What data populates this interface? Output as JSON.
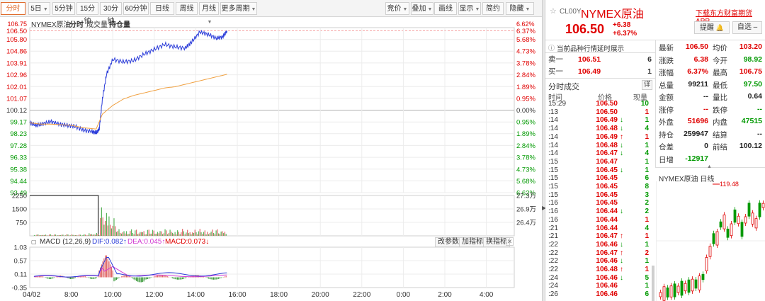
{
  "toolbar": {
    "tabs": [
      {
        "label": "分时",
        "active": true
      },
      {
        "label": "5日",
        "caret": true
      },
      {
        "label": "5分钟"
      },
      {
        "label": "15分钟"
      },
      {
        "label": "30分钟"
      },
      {
        "label": "60分钟"
      },
      {
        "label": "日线"
      },
      {
        "label": "周线"
      },
      {
        "label": "月线",
        "caret": true
      },
      {
        "label": "更多周期",
        "caret": true
      }
    ],
    "right_buttons": [
      {
        "label": "竞价",
        "caret": true
      },
      {
        "label": "叠加",
        "caret": true
      },
      {
        "label": "画线"
      },
      {
        "label": "显示",
        "caret": true
      },
      {
        "label": "简约"
      },
      {
        "label": "隐藏",
        "caret": true
      }
    ]
  },
  "chart_header": {
    "name": "NYMEX原油",
    "tab_fenshi": "分时",
    "tab_volume": "成交量",
    "tab_oi": "持仓量"
  },
  "price_axis": {
    "labels": [
      "106.50",
      "105.80",
      "104.86",
      "103.91",
      "102.96",
      "102.01",
      "101.07",
      "100.12",
      "99.17",
      "98.23",
      "97.28",
      "96.33",
      "95.38",
      "94.44",
      "93.49"
    ],
    "pct_labels": [
      "6.37%",
      "5.68%",
      "4.73%",
      "3.78%",
      "2.84%",
      "1.89%",
      "0.95%",
      "0.00%",
      "0.95%",
      "1.89%",
      "2.84%",
      "3.78%",
      "4.73%",
      "5.68%",
      "6.62%"
    ],
    "top_partial_left": "106.75",
    "top_partial_right": "6.62%"
  },
  "volume_axis": {
    "left": [
      "2250",
      "1500",
      "750"
    ],
    "right": [
      "27.3万",
      "26.9万",
      "26.4万"
    ]
  },
  "macd": {
    "title": "MACD (12,26,9)",
    "dif": "DIF:0.082↑",
    "dea": "DEA:0.045↑",
    "macd": "MACD:0.073↓",
    "y_labels": [
      "1.03",
      "0.57",
      "0.11",
      "-0.35"
    ],
    "buttons": [
      "改参数",
      "加指标",
      "换指标"
    ]
  },
  "time_axis": [
    "04/02",
    "8:00",
    "10:00",
    "12:00",
    "14:00",
    "16:00",
    "18:00",
    "20:00",
    "22:00",
    "0:00",
    "2:00",
    "4:00"
  ],
  "chart_data": {
    "type": "line",
    "x": [
      "04/02",
      "8:00",
      "10:00",
      "12:00",
      "14:00",
      "16:00",
      "18:00",
      "20:00",
      "22:00",
      "0:00",
      "2:00",
      "4:00"
    ],
    "ylim": [
      93.49,
      106.75
    ],
    "prev_close": 100.12,
    "series": [
      {
        "color": "#2b3cd9",
        "points": [
          [
            6.0,
            99.1
          ],
          [
            6.3,
            98.9
          ],
          [
            6.6,
            99.0
          ],
          [
            7.0,
            99.2
          ],
          [
            7.4,
            99.0
          ],
          [
            7.8,
            98.9
          ],
          [
            8.2,
            98.8
          ],
          [
            8.6,
            98.5
          ],
          [
            9.0,
            98.4
          ],
          [
            9.2,
            98.3
          ],
          [
            9.35,
            98.6
          ],
          [
            9.5,
            101.0
          ],
          [
            9.7,
            103.0
          ],
          [
            10.0,
            104.2
          ],
          [
            10.5,
            104.0
          ],
          [
            11.0,
            104.1
          ],
          [
            11.5,
            104.6
          ],
          [
            12.0,
            105.0
          ],
          [
            12.5,
            105.4
          ],
          [
            13.0,
            105.2
          ],
          [
            13.5,
            105.1
          ],
          [
            13.8,
            105.6
          ],
          [
            14.2,
            106.4
          ],
          [
            14.6,
            106.2
          ],
          [
            15.0,
            105.9
          ],
          [
            15.3,
            106.0
          ],
          [
            15.5,
            106.5
          ]
        ]
      },
      {
        "color": "#f0a040",
        "points": [
          [
            6.0,
            99.1
          ],
          [
            6.5,
            99.0
          ],
          [
            7.0,
            99.0
          ],
          [
            8.0,
            98.9
          ],
          [
            8.6,
            98.7
          ],
          [
            9.2,
            98.6
          ],
          [
            9.5,
            99.8
          ],
          [
            10.0,
            100.5
          ],
          [
            10.5,
            101.0
          ],
          [
            11.0,
            101.3
          ],
          [
            11.5,
            101.5
          ],
          [
            12.0,
            101.7
          ],
          [
            12.5,
            101.9
          ],
          [
            13.0,
            102.0
          ],
          [
            13.5,
            102.2
          ],
          [
            14.0,
            102.4
          ],
          [
            14.5,
            102.6
          ],
          [
            15.0,
            102.8
          ],
          [
            15.5,
            103.0
          ]
        ]
      }
    ],
    "volume": {
      "ylim": [
        0,
        2250
      ],
      "open_interest_line": {
        "level": 2250,
        "end_hour": 9.3
      }
    },
    "macd": {
      "ylim": [
        -0.35,
        1.03
      ]
    }
  },
  "quote": {
    "code": "CL00Y",
    "name": "NYMEX原油",
    "star_icon": "star",
    "price": "106.50",
    "change": "+6.38",
    "change_pct": "+6.37%",
    "download_link": "下载东方财富期货APP",
    "alert_btn": "提醒",
    "watch_btn": "自选",
    "notice": "当前品种行情延时展示",
    "sell1_label": "卖一",
    "sell1_price": "106.51",
    "sell1_vol": "6",
    "buy1_label": "买一",
    "buy1_price": "106.49",
    "buy1_vol": "1"
  },
  "stats": [
    {
      "l1": "最新",
      "v1": "106.50",
      "c1": "red",
      "l2": "均价",
      "v2": "103.20",
      "c2": "red"
    },
    {
      "l1": "涨跌",
      "v1": "6.38",
      "c1": "red",
      "l2": "今开",
      "v2": "98.92",
      "c2": "green"
    },
    {
      "l1": "涨幅",
      "v1": "6.37%",
      "c1": "red",
      "l2": "最高",
      "v2": "106.75",
      "c2": "red"
    },
    {
      "l1": "总量",
      "v1": "99211",
      "c1": "dark",
      "l2": "最低",
      "v2": "97.50",
      "c2": "green"
    },
    {
      "l1": "金额",
      "v1": "--",
      "c1": "dark",
      "l2": "量比",
      "v2": "0.64",
      "c2": "dark"
    },
    {
      "l1": "涨停",
      "v1": "--",
      "c1": "red",
      "l2": "跌停",
      "v2": "--",
      "c2": "green"
    },
    {
      "l1": "外盘",
      "v1": "51696",
      "c1": "red",
      "l2": "内盘",
      "v2": "47515",
      "c2": "green"
    },
    {
      "l1": "持仓",
      "v1": "259947",
      "c1": "dark",
      "l2": "结算",
      "v2": "--",
      "c2": "dark"
    },
    {
      "l1": "仓差",
      "v1": "0",
      "c1": "dark",
      "l2": "前结",
      "v2": "100.12",
      "c2": "dark"
    },
    {
      "l1": "日增",
      "v1": "-12917",
      "c1": "green",
      "l2": "",
      "v2": "",
      "c2": "dark"
    }
  ],
  "ticks": {
    "title": "分时成交",
    "detail_btn": "详",
    "headers": [
      "时间",
      "价格",
      "现量"
    ],
    "rows": [
      {
        "t": "15:29",
        "p": "106.50",
        "a": "",
        "v": "10",
        "vc": "green"
      },
      {
        "t": ":13",
        "p": "106.50",
        "a": "",
        "v": "1",
        "vc": "red"
      },
      {
        "t": ":14",
        "p": "106.49",
        "a": "↓",
        "v": "1",
        "vc": "green"
      },
      {
        "t": ":14",
        "p": "106.48",
        "a": "↓",
        "v": "4",
        "vc": "green"
      },
      {
        "t": ":14",
        "p": "106.49",
        "a": "↑",
        "v": "1",
        "vc": "red"
      },
      {
        "t": ":14",
        "p": "106.48",
        "a": "↓",
        "v": "1",
        "vc": "green"
      },
      {
        "t": ":14",
        "p": "106.47",
        "a": "↓",
        "v": "4",
        "vc": "green"
      },
      {
        "t": ":15",
        "p": "106.47",
        "a": "",
        "v": "1",
        "vc": "green"
      },
      {
        "t": ":15",
        "p": "106.45",
        "a": "↓",
        "v": "1",
        "vc": "green"
      },
      {
        "t": ":15",
        "p": "106.45",
        "a": "",
        "v": "6",
        "vc": "green"
      },
      {
        "t": ":15",
        "p": "106.45",
        "a": "",
        "v": "8",
        "vc": "green"
      },
      {
        "t": ":15",
        "p": "106.45",
        "a": "",
        "v": "3",
        "vc": "green"
      },
      {
        "t": ":16",
        "p": "106.45",
        "a": "",
        "v": "2",
        "vc": "green"
      },
      {
        "t": ":16",
        "p": "106.44",
        "a": "↓",
        "v": "2",
        "vc": "green"
      },
      {
        "t": ":16",
        "p": "106.44",
        "a": "",
        "v": "1",
        "vc": "red"
      },
      {
        "t": ":21",
        "p": "106.44",
        "a": "",
        "v": "4",
        "vc": "green"
      },
      {
        "t": ":21",
        "p": "106.47",
        "a": "↑",
        "v": "1",
        "vc": "red"
      },
      {
        "t": ":22",
        "p": "106.46",
        "a": "↓",
        "v": "1",
        "vc": "green"
      },
      {
        "t": ":22",
        "p": "106.47",
        "a": "↑",
        "v": "2",
        "vc": "red"
      },
      {
        "t": ":22",
        "p": "106.46",
        "a": "↓",
        "v": "1",
        "vc": "green"
      },
      {
        "t": ":22",
        "p": "106.48",
        "a": "↑",
        "v": "1",
        "vc": "red"
      },
      {
        "t": ":24",
        "p": "106.46",
        "a": "↓",
        "v": "5",
        "vc": "green"
      },
      {
        "t": ":24",
        "p": "106.46",
        "a": "",
        "v": "1",
        "vc": "green"
      },
      {
        "t": ":26",
        "p": "106.46",
        "a": "",
        "v": "6",
        "vc": "green"
      }
    ]
  },
  "daily": {
    "title": "NYMEX原油 日线",
    "peak_label": "119.48"
  }
}
